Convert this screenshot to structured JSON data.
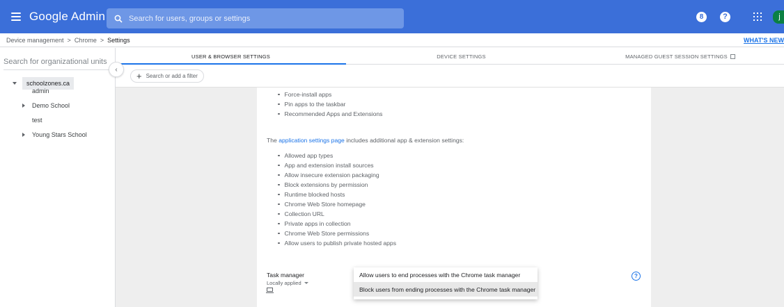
{
  "header": {
    "app_title": "Google Admin",
    "search_placeholder": "Search for users, groups or settings",
    "badge_count": "8",
    "help": "?",
    "avatar_initial": "j"
  },
  "breadcrumb": {
    "items": [
      "Device management",
      "Chrome",
      "Settings"
    ],
    "separator": ">",
    "whats_new": "WHAT'S NEW"
  },
  "sidebar": {
    "search_placeholder": "Search for organizational units",
    "root": "schoolzones.ca",
    "items": [
      {
        "label": "admin"
      },
      {
        "label": "Demo School"
      },
      {
        "label": "test"
      },
      {
        "label": "Young Stars School"
      }
    ]
  },
  "tabs": [
    {
      "label": "USER & BROWSER SETTINGS"
    },
    {
      "label": "DEVICE SETTINGS"
    },
    {
      "label": "MANAGED GUEST SESSION SETTINGS"
    }
  ],
  "filter": {
    "label": "Search or add a filter"
  },
  "content": {
    "top_bullets": [
      "Force-install apps",
      "Pin apps to the taskbar",
      "Recommended Apps and Extensions"
    ],
    "para_prefix": "The ",
    "para_link": "application settings page",
    "para_suffix": " includes additional app & extension settings:",
    "bullets": [
      "Allowed app types",
      "App and extension install sources",
      "Allow insecure extension packaging",
      "Block extensions by permission",
      "Runtime blocked hosts",
      "Chrome Web Store homepage",
      "Collection URL",
      "Private apps in collection",
      "Chrome Web Store permissions",
      "Allow users to publish private hosted apps"
    ],
    "setting_title": "Task manager",
    "setting_sub": "Locally applied",
    "help": "?"
  },
  "dropdown": {
    "options": [
      "Allow users to end processes with the Chrome task manager",
      "Block users from ending processes with the Chrome task manager"
    ]
  }
}
